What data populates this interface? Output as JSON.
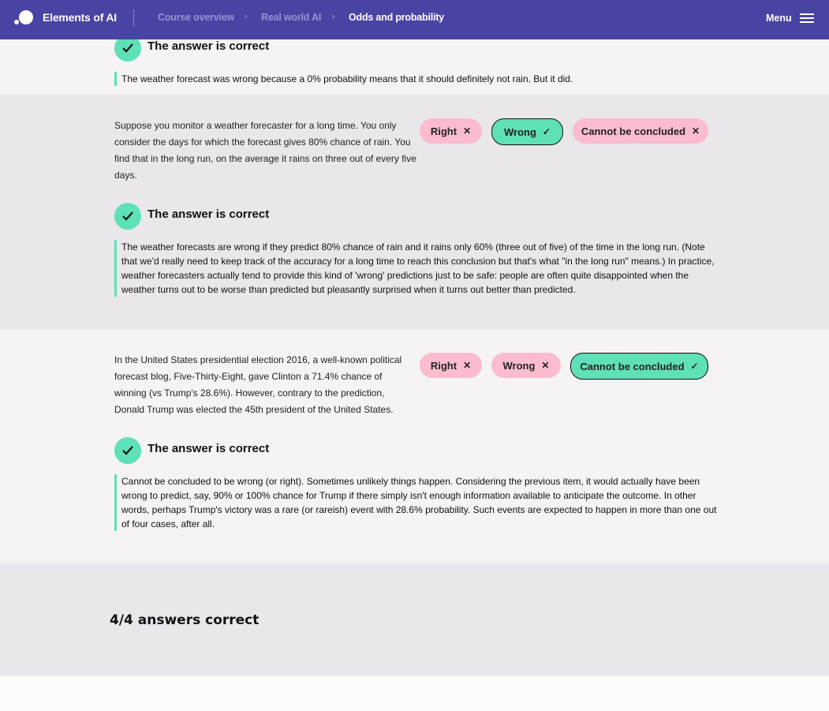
{
  "header": {
    "brand": "Elements of AI",
    "breadcrumbs": [
      "Course overview",
      "Real world AI",
      "Odds and probability"
    ],
    "menu_label": "Menu"
  },
  "items": [
    {
      "correct_title": "The answer is correct",
      "explanation": "The weather forecast was wrong because a 0% probability means that it should definitely not rain. But it did."
    },
    {
      "question": "Suppose you monitor a weather forecaster for a long time. You only consider the days for which the forecast gives 80% chance of rain. You find that in the long run, on the average it rains on three out of every five days.",
      "options": [
        {
          "label": "Right",
          "mark": "✕",
          "selected": false
        },
        {
          "label": "Wrong",
          "mark": "✓",
          "selected": true
        },
        {
          "label": "Cannot be concluded",
          "mark": "✕",
          "selected": false
        }
      ],
      "correct_title": "The answer is correct",
      "explanation": "The weather forecasts are wrong if they predict 80% chance of rain and it rains only 60% (three out of five) of the time in the long run. (Note that we'd really need to keep track of the accuracy for a long time to reach this conclusion but that's what \"in the long run\" means.) In practice, weather forecasters actually tend to provide this kind of 'wrong' predictions just to be safe: people are often quite disappointed when the weather turns out to be worse than predicted but pleasantly surprised when it turns out better than predicted."
    },
    {
      "question": "In the United States presidential election 2016, a well-known political forecast blog, Five-Thirty-Eight, gave Clinton a 71.4% chance of winning (vs Trump's 28.6%). However, contrary to the prediction, Donald Trump was elected the 45th president of the United States.",
      "options": [
        {
          "label": "Right",
          "mark": "✕",
          "selected": false
        },
        {
          "label": "Wrong",
          "mark": "✕",
          "selected": false
        },
        {
          "label": "Cannot be concluded",
          "mark": "✓",
          "selected": true
        }
      ],
      "correct_title": "The answer is correct",
      "explanation": "Cannot be concluded to be wrong (or right). Sometimes unlikely things happen. Considering the previous item, it would actually have been wrong to predict, say, 90% or 100% chance for Trump if there simply isn't enough information available to anticipate the outcome. In other words, perhaps Trump's victory was a rare (or rareish) event with 28.6% probability. Such events are expected to happen in more than one out of four cases, after all."
    }
  ],
  "score": "4/4 answers correct",
  "colors": {
    "header": "#4844a3",
    "correct": "#5ee0b8",
    "wrong_option": "#fbbccd"
  }
}
